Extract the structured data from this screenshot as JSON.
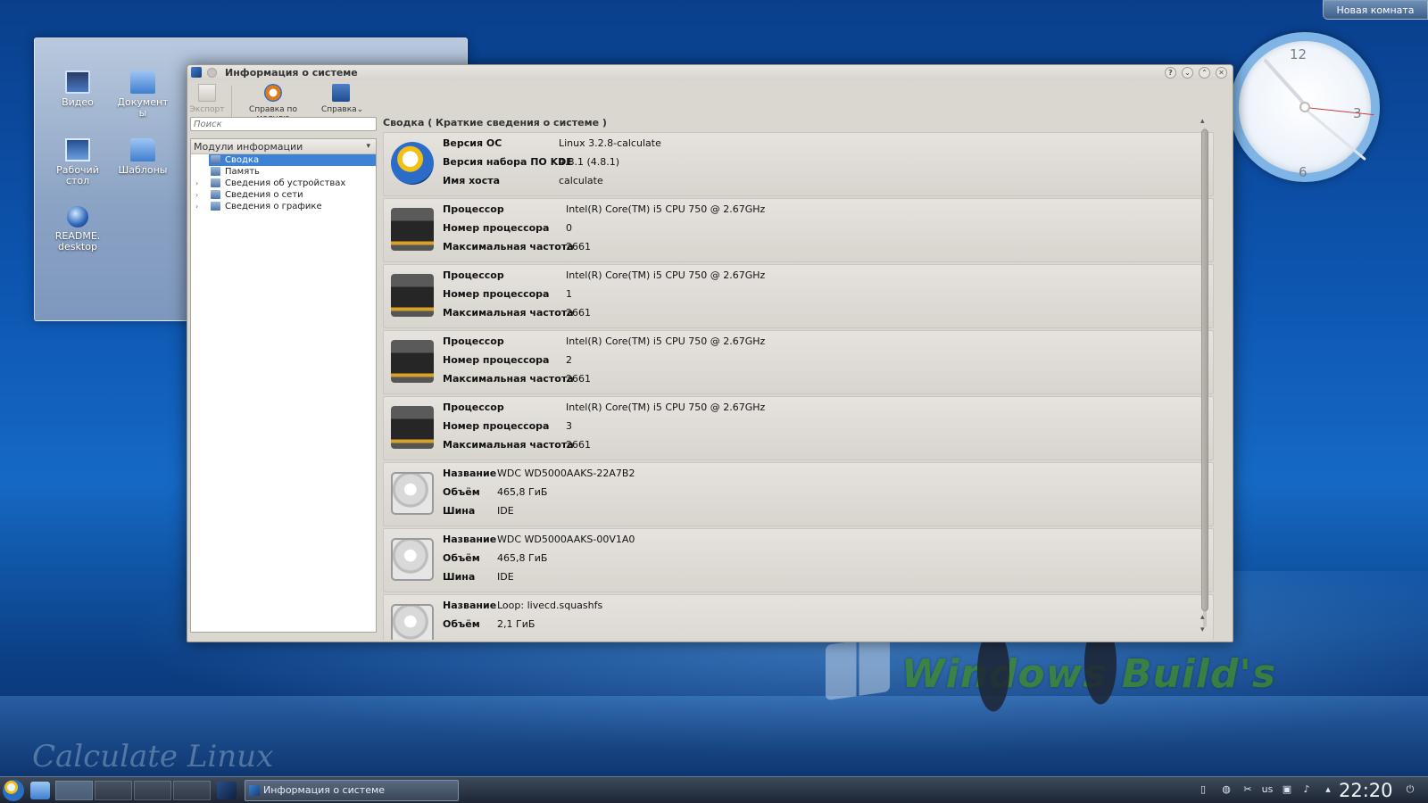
{
  "desktop": {
    "room_button": "Новая комната",
    "icons": [
      {
        "label_line1": "Видео",
        "label_line2": ""
      },
      {
        "label_line1": "Документ",
        "label_line2": "ы"
      },
      {
        "label_line1": "Рабочий",
        "label_line2": "стол"
      },
      {
        "label_line1": "Шаблоны",
        "label_line2": ""
      },
      {
        "label_line1": "README.",
        "label_line2": "desktop"
      }
    ],
    "clock_numbers": [
      "12",
      "3",
      "6"
    ],
    "watermark": "Windows Build's",
    "brand": "Calculate Linux"
  },
  "window": {
    "title": "Информация о системе",
    "toolbar": {
      "export": "Экспорт",
      "module_help": "Справка по модулю",
      "help": "Справка"
    },
    "search_placeholder": "Поиск",
    "modules_header": "Модули информации",
    "tree": [
      {
        "label": "Сводка",
        "selected": true,
        "expandable": false
      },
      {
        "label": "Память",
        "selected": false,
        "expandable": false
      },
      {
        "label": "Сведения об устройствах",
        "selected": false,
        "expandable": true
      },
      {
        "label": "Сведения о сети",
        "selected": false,
        "expandable": true
      },
      {
        "label": "Сведения о графике",
        "selected": false,
        "expandable": true
      }
    ],
    "breadcrumb": "Сводка  ( Краткие сведения о системе )",
    "os": {
      "rows": [
        {
          "k": "Версия ОС",
          "v": "Linux 3.2.8-calculate"
        },
        {
          "k": "Версия набора ПО KDE",
          "v": "4.8.1 (4.8.1)"
        },
        {
          "k": "Имя хоста",
          "v": "calculate"
        }
      ]
    },
    "cpus": [
      {
        "rows": [
          {
            "k": "Процессор",
            "v": "Intel(R) Core(TM) i5 CPU       750  @ 2.67GHz"
          },
          {
            "k": "Номер процессора",
            "v": "0"
          },
          {
            "k": "Максимальная частота",
            "v": "2661"
          }
        ]
      },
      {
        "rows": [
          {
            "k": "Процессор",
            "v": "Intel(R) Core(TM) i5 CPU       750  @ 2.67GHz"
          },
          {
            "k": "Номер процессора",
            "v": "1"
          },
          {
            "k": "Максимальная частота",
            "v": "2661"
          }
        ]
      },
      {
        "rows": [
          {
            "k": "Процессор",
            "v": "Intel(R) Core(TM) i5 CPU       750  @ 2.67GHz"
          },
          {
            "k": "Номер процессора",
            "v": "2"
          },
          {
            "k": "Максимальная частота",
            "v": "2661"
          }
        ]
      },
      {
        "rows": [
          {
            "k": "Процессор",
            "v": "Intel(R) Core(TM) i5 CPU       750  @ 2.67GHz"
          },
          {
            "k": "Номер процессора",
            "v": "3"
          },
          {
            "k": "Максимальная частота",
            "v": "2661"
          }
        ]
      }
    ],
    "disks": [
      {
        "rows": [
          {
            "k": "Название",
            "v": "WDC WD5000AAKS-22A7B2"
          },
          {
            "k": "Объём",
            "v": "465,8 ГиБ"
          },
          {
            "k": "Шина",
            "v": "IDE"
          }
        ]
      },
      {
        "rows": [
          {
            "k": "Название",
            "v": "WDC WD5000AAKS-00V1A0"
          },
          {
            "k": "Объём",
            "v": "465,8 ГиБ"
          },
          {
            "k": "Шина",
            "v": "IDE"
          }
        ]
      },
      {
        "rows": [
          {
            "k": "Название",
            "v": "Loop: livecd.squashfs"
          },
          {
            "k": "Объём",
            "v": "2,1 ГиБ"
          }
        ]
      }
    ]
  },
  "taskbar": {
    "task_label": "Информация о системе",
    "keyboard_layout": "us",
    "time": "22:20"
  }
}
